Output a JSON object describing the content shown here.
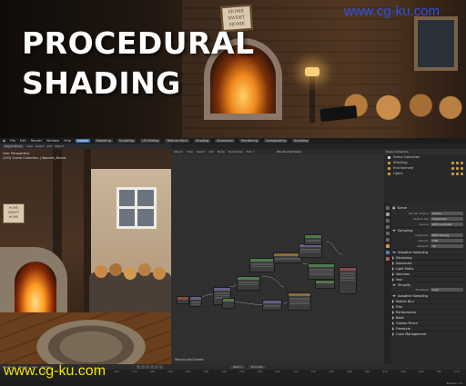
{
  "watermark": "www.cg-ku.com",
  "hero": {
    "title_line1": "PROCEDURAL",
    "title_line2": "SHADING",
    "sign_text": "HOME SWEET HOME"
  },
  "app": {
    "menu": [
      "File",
      "Edit",
      "Render",
      "Window",
      "Help"
    ],
    "workspaces": [
      "Layout",
      "Modeling",
      "Sculpting",
      "UV Editing",
      "Texture Paint",
      "Shading",
      "Animation",
      "Rendering",
      "Compositing",
      "Scripting"
    ],
    "active_workspace": "Layout",
    "viewport": {
      "mode": "Object Mode",
      "menus": [
        "View",
        "Select",
        "Add",
        "Object"
      ],
      "perspective": "User Perspective",
      "collection": "(453) Scene Collection | Wooden_Board",
      "sign_text": "HOME SWEET HOME"
    },
    "node_editor": {
      "header": [
        "Object",
        "View",
        "Select",
        "Add",
        "Node",
        "Use Nodes",
        "Slot 1"
      ],
      "breadcrumb": "WoodLumpShader",
      "material_name": "WoodLumpShader"
    },
    "outliner": {
      "header": "Scene Collection",
      "items": [
        {
          "name": "Scene Collection"
        },
        {
          "name": "Stitching"
        },
        {
          "name": "Environment"
        },
        {
          "name": "Lights"
        }
      ]
    },
    "properties": {
      "scene_label": "Scene",
      "rows": [
        {
          "label": "Render Engine",
          "value": "Cycles"
        },
        {
          "label": "Feature Set",
          "value": "Supported"
        },
        {
          "label": "Device",
          "value": "GPU Compute"
        }
      ],
      "sampling_label": "Sampling",
      "sampling_rows": [
        {
          "label": "Integrator",
          "value": "Path Tracing"
        },
        {
          "label": "Render",
          "value": "128"
        },
        {
          "label": "Viewport",
          "value": "32"
        }
      ],
      "sections": [
        "Adaptive Sampling",
        "Denoising",
        "Advanced",
        "Light Paths",
        "Volumes",
        "Hair",
        "Simplify",
        "Motion Blur",
        "Film",
        "Performance",
        "Bake",
        "Grease Pencil",
        "Freestyle",
        "Color Management"
      ],
      "inline_label": "Adaptive Sampling",
      "inline_rows": [
        {
          "label": "Threshold",
          "value": "0.01"
        }
      ]
    },
    "timeline": {
      "menus": [
        "Playback",
        "Keying",
        "View",
        "Marker"
      ],
      "start_label": "Start",
      "start": "1",
      "end_label": "End",
      "end": "250",
      "ticks": [
        "0",
        "20",
        "40",
        "60",
        "80",
        "100",
        "120",
        "140",
        "160",
        "180",
        "200",
        "220",
        "240",
        "260",
        "280",
        "300",
        "320",
        "340",
        "360",
        "380",
        "400",
        "420",
        "440",
        "460",
        "480",
        "500"
      ],
      "version": "Blender 3.0"
    }
  }
}
